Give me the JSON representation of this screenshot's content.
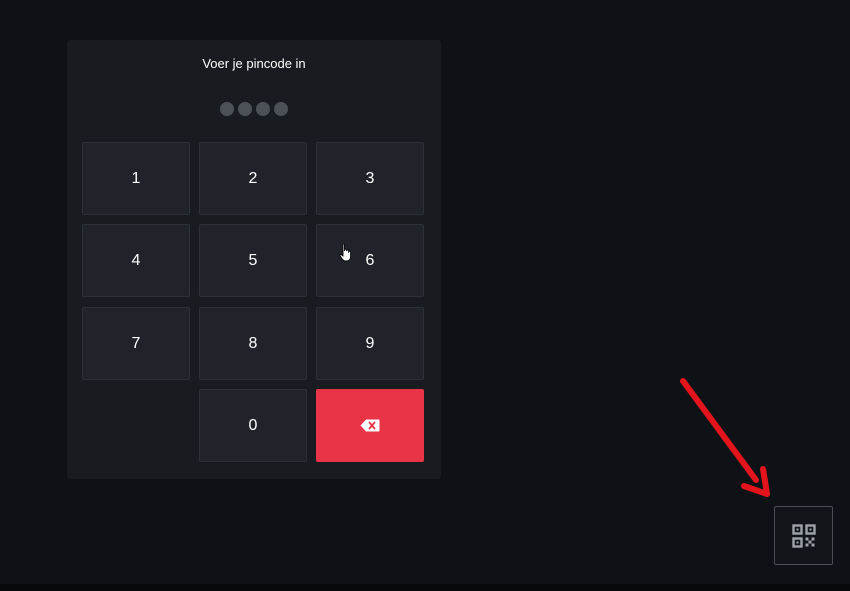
{
  "pin_panel": {
    "title": "Voer je pincode in",
    "pin_length": 4,
    "keys": [
      {
        "label": "1"
      },
      {
        "label": "2"
      },
      {
        "label": "3"
      },
      {
        "label": "4"
      },
      {
        "label": "5"
      },
      {
        "label": "6"
      },
      {
        "label": "7"
      },
      {
        "label": "8"
      },
      {
        "label": "9"
      },
      {
        "label": "0"
      }
    ],
    "backspace_icon": "backspace-icon"
  },
  "qr_button": {
    "icon": "qr-code-icon"
  },
  "annotation": {
    "icon": "red-arrow-icon"
  },
  "colors": {
    "background": "#0e1115",
    "panel": "#181b20",
    "key": "#20242a",
    "backspace": "#e93347",
    "pin_dot": "#4c5057",
    "arrow": "#e4141c"
  }
}
